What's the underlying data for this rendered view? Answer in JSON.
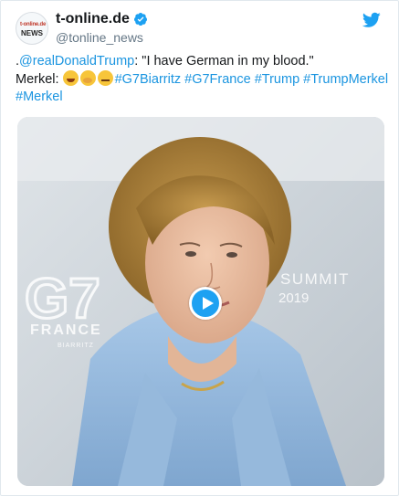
{
  "account": {
    "display_name": "t-online.de",
    "handle": "@tonline_news",
    "avatar_text_top": "t-online.de",
    "avatar_text_bottom": "NEWS"
  },
  "tweet": {
    "line1_prefix": ".",
    "mention": "@realDonaldTrump",
    "line1_quote": ": \"I have German in my blood.\"",
    "line2_prefix": "Merkel: ",
    "hashtags": [
      "#G7Biarritz",
      "#G7France",
      "#Trump",
      "#TrumpMerkel",
      "#Merkel"
    ]
  },
  "media": {
    "backdrop_logo": "G7",
    "backdrop_country": "FRANCE",
    "backdrop_subtext": "BIARRITZ",
    "backdrop_summit": "SUMMIT",
    "backdrop_year": "2019"
  },
  "colors": {
    "link": "#1b95e0",
    "verified": "#1da1f2",
    "text": "#14171a",
    "muted": "#657786"
  },
  "icons": {
    "verified": "verified-badge-icon",
    "bird": "twitter-bird-icon",
    "play": "play-icon"
  }
}
